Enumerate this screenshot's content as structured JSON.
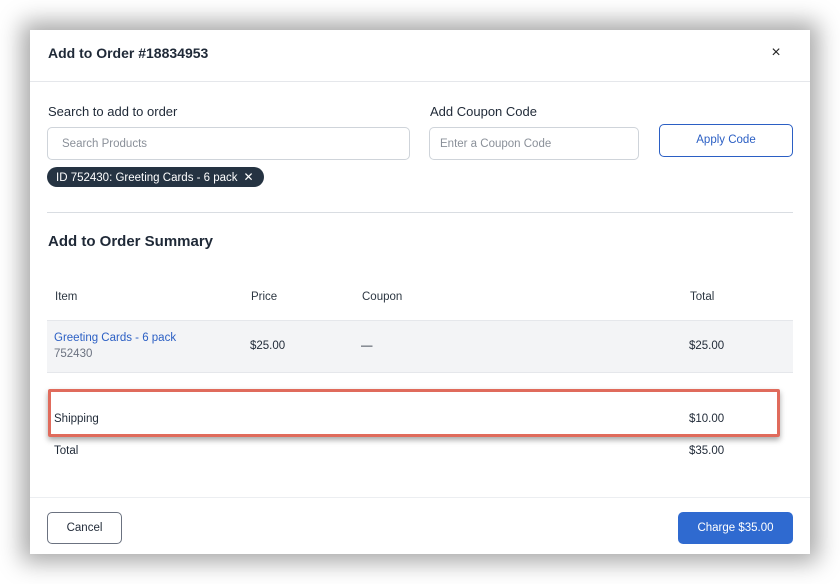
{
  "modal": {
    "title": "Add to Order #18834953",
    "close_icon": "×"
  },
  "search": {
    "label": "Search to add to order",
    "placeholder": "Search Products",
    "value": "",
    "chips": [
      {
        "label": "ID 752430: Greeting Cards - 6 pack",
        "remove_icon": "✕"
      }
    ]
  },
  "coupon": {
    "label": "Add Coupon Code",
    "placeholder": "Enter a Coupon Code",
    "value": "",
    "apply_label": "Apply Code"
  },
  "summary": {
    "title": "Add to Order Summary",
    "columns": {
      "item": "Item",
      "price": "Price",
      "coupon": "Coupon",
      "total": "Total"
    },
    "rows": [
      {
        "name": "Greeting Cards - 6 pack",
        "sku": "752430",
        "price": "$25.00",
        "coupon": "—",
        "total": "$25.00"
      }
    ],
    "shipping": {
      "label": "Shipping",
      "value": "$10.00"
    },
    "grand_total": {
      "label": "Total",
      "value": "$35.00"
    }
  },
  "footer": {
    "cancel_label": "Cancel",
    "charge_label": "Charge $35.00"
  },
  "colors": {
    "accent": "#2f6ad0",
    "link": "#2b5fc4",
    "chip_bg": "#253342",
    "highlight": "#e06b5c"
  }
}
